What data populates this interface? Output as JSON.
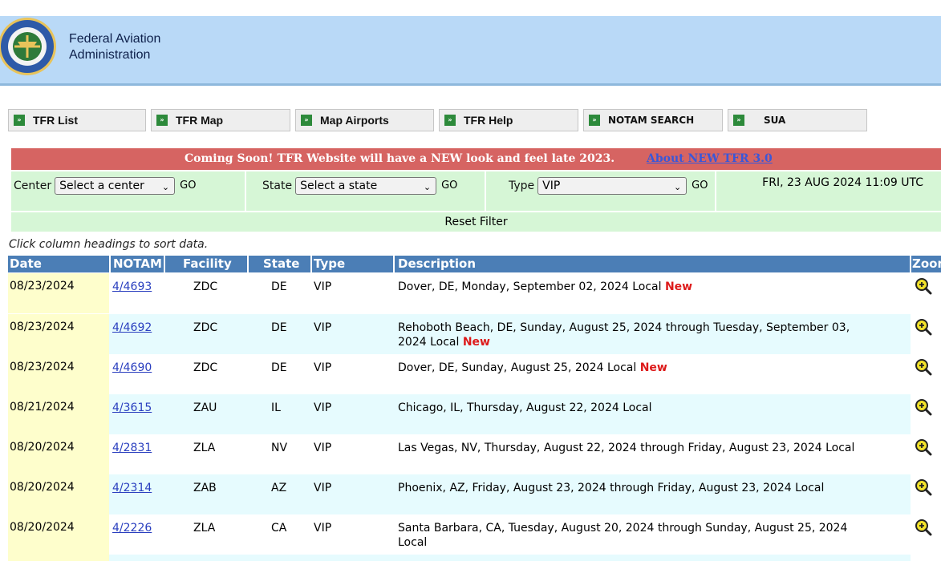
{
  "header": {
    "org_line1": "Federal Aviation",
    "org_line2": "Administration",
    "logo_icon": "faa-seal-icon"
  },
  "nav": [
    {
      "label": "TFR List"
    },
    {
      "label": "TFR Map"
    },
    {
      "label": "Map Airports"
    },
    {
      "label": "TFR Help"
    },
    {
      "label": "NOTAM SEARCH"
    },
    {
      "label": "SUA"
    }
  ],
  "announce": {
    "text": "Coming Soon! TFR Website will have a NEW look and feel late 2023.",
    "link": "About NEW TFR 3.0"
  },
  "filter": {
    "center_label": "Center",
    "center_value": "Select a center",
    "state_label": "State",
    "state_value": "Select a state",
    "type_label": "Type",
    "type_value": "VIP",
    "go": "GO",
    "datetime": "FRI, 23 AUG 2024 11:09 UTC",
    "reset": "Reset Filter"
  },
  "hint": "Click column headings to sort data.",
  "table": {
    "headers": [
      "Date",
      "NOTAM",
      "Facility",
      "State",
      "Type",
      "Description",
      "Zoom"
    ],
    "rows": [
      {
        "date": "08/23/2024",
        "notam": "4/4693",
        "facility": "ZDC",
        "state": "DE",
        "type": "VIP",
        "desc1": "Dover, DE, Monday, September 02, 2024 Local",
        "desc2": "",
        "new": "New"
      },
      {
        "date": "08/23/2024",
        "notam": "4/4692",
        "facility": "ZDC",
        "state": "DE",
        "type": "VIP",
        "desc1": "Rehoboth Beach, DE, Sunday, August 25, 2024 through Tuesday, September 03,",
        "desc2": "2024 Local",
        "new": "New"
      },
      {
        "date": "08/23/2024",
        "notam": "4/4690",
        "facility": "ZDC",
        "state": "DE",
        "type": "VIP",
        "desc1": "Dover, DE, Sunday, August 25, 2024 Local",
        "desc2": "",
        "new": "New"
      },
      {
        "date": "08/21/2024",
        "notam": "4/3615",
        "facility": "ZAU",
        "state": "IL",
        "type": "VIP",
        "desc1": "Chicago, IL, Thursday, August 22, 2024 Local",
        "desc2": "",
        "new": ""
      },
      {
        "date": "08/20/2024",
        "notam": "4/2831",
        "facility": "ZLA",
        "state": "NV",
        "type": "VIP",
        "desc1": "Las Vegas, NV, Thursday, August 22, 2024 through Friday, August 23, 2024 Local",
        "desc2": "",
        "new": ""
      },
      {
        "date": "08/20/2024",
        "notam": "4/2314",
        "facility": "ZAB",
        "state": "AZ",
        "type": "VIP",
        "desc1": "Phoenix, AZ, Friday, August 23, 2024 through Friday, August 23, 2024 Local",
        "desc2": "",
        "new": ""
      },
      {
        "date": "08/20/2024",
        "notam": "4/2226",
        "facility": "ZLA",
        "state": "CA",
        "type": "VIP",
        "desc1": "Santa Barbara, CA, Tuesday, August 20, 2024 through Sunday, August 25, 2024",
        "desc2": "Local",
        "new": ""
      }
    ]
  },
  "colors": {
    "header_bg": "#b9d9f7",
    "announce_bg": "#d66462",
    "filter_bg": "#d6f6d6",
    "table_head_bg": "#4b7eb6",
    "row_alt_bg": "#e6fbfe",
    "date_col_bg": "#fefecc",
    "new_red": "#dd1b1b"
  },
  "icons": {
    "nav_bullet": "double-arrow-icon",
    "zoom": "zoom-in-magnifier-icon",
    "select_arrow": "chevron-down-icon"
  }
}
